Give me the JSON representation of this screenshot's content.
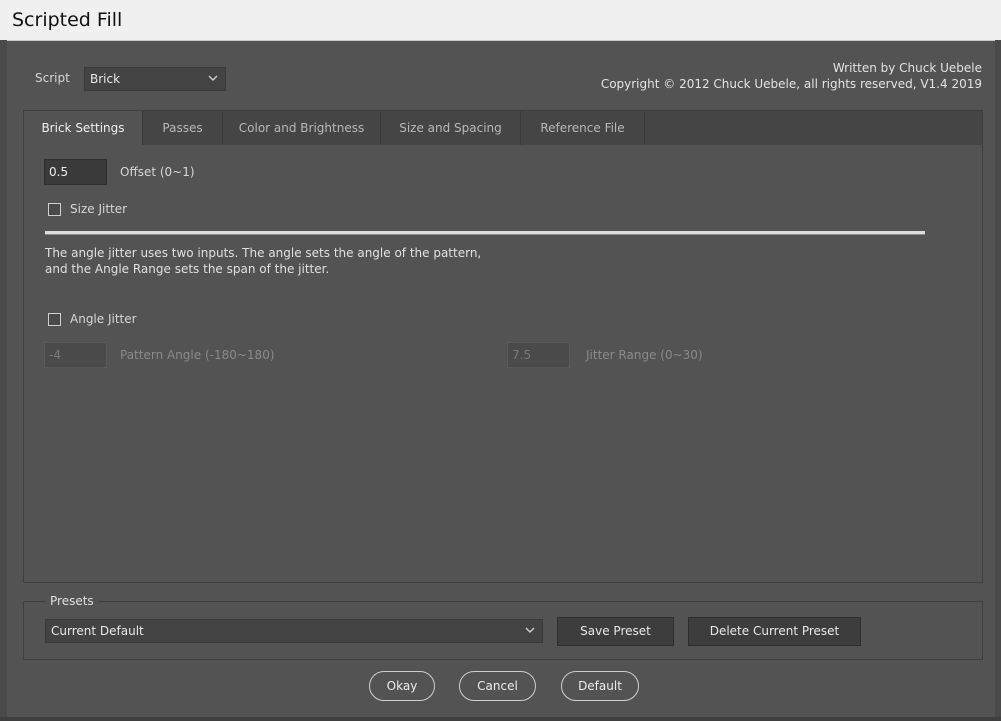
{
  "window": {
    "title": "Scripted Fill"
  },
  "script": {
    "label": "Script",
    "selected": "Brick"
  },
  "credits": {
    "line1": "Written by Chuck Uebele",
    "line2": "Copyright © 2012 Chuck Uebele, all rights reserved, V1.4 2019"
  },
  "tabs": [
    {
      "label": "Brick Settings",
      "active": true
    },
    {
      "label": "Passes"
    },
    {
      "label": "Color and Brightness"
    },
    {
      "label": "Size and Spacing"
    },
    {
      "label": "Reference File"
    }
  ],
  "brick": {
    "offset_value": "0.5",
    "offset_label": "Offset (0~1)",
    "size_jitter_label": "Size Jitter",
    "size_jitter_checked": false,
    "description_line1": "The angle jitter uses two inputs.  The angle sets the angle of the pattern,",
    "description_line2": "and the Angle Range sets the span of the jitter.",
    "angle_jitter_label": "Angle Jitter",
    "angle_jitter_checked": false,
    "pattern_angle_value": "-4",
    "pattern_angle_label": "Pattern Angle (-180~180)",
    "jitter_range_value": "7.5",
    "jitter_range_label": "Jitter Range (0~30)"
  },
  "presets": {
    "label": "Presets",
    "selected": "Current Default",
    "save_label": "Save Preset",
    "delete_label": "Delete Current Preset"
  },
  "buttons": {
    "okay": "Okay",
    "cancel": "Cancel",
    "default": "Default"
  }
}
